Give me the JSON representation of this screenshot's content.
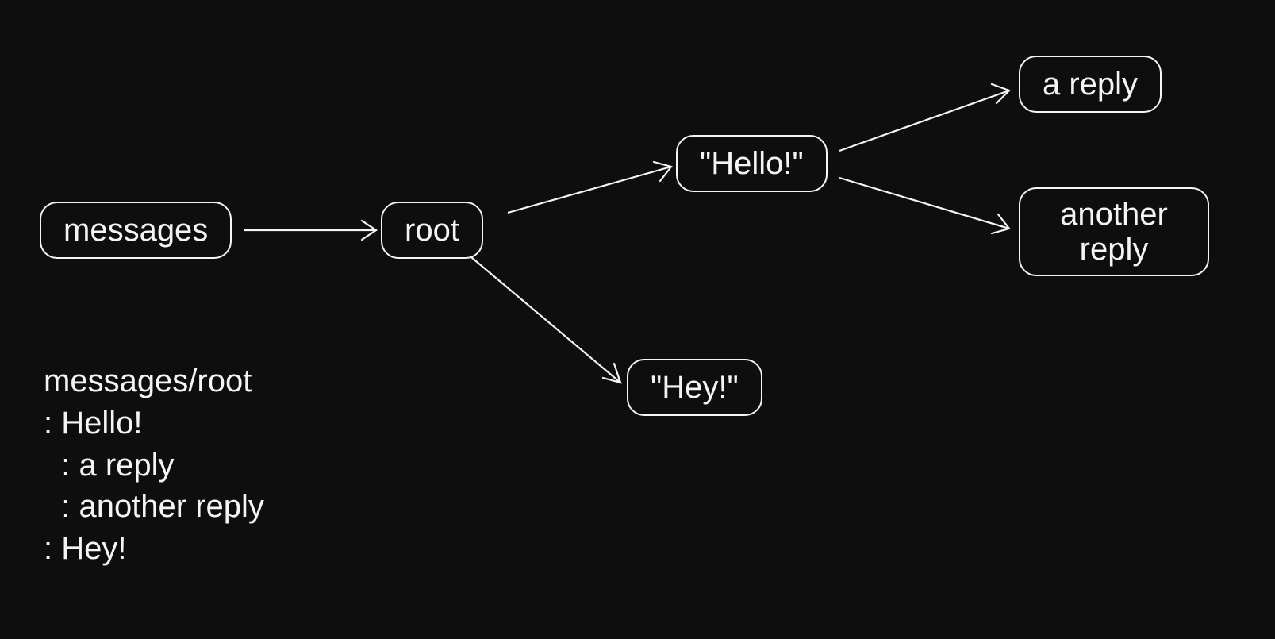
{
  "nodes": {
    "messages": "messages",
    "root": "root",
    "hello": "\"Hello!\"",
    "hey": "\"Hey!\"",
    "a_reply": "a reply",
    "another_reply": "another reply"
  },
  "tree_text": {
    "l1": "messages/root",
    "l2": ": Hello!",
    "l3": "  : a reply",
    "l4": "  : another reply",
    "l5": ": Hey!"
  },
  "edges": [
    {
      "from": "messages",
      "to": "root"
    },
    {
      "from": "root",
      "to": "hello"
    },
    {
      "from": "root",
      "to": "hey"
    },
    {
      "from": "hello",
      "to": "a_reply"
    },
    {
      "from": "hello",
      "to": "another_reply"
    }
  ]
}
